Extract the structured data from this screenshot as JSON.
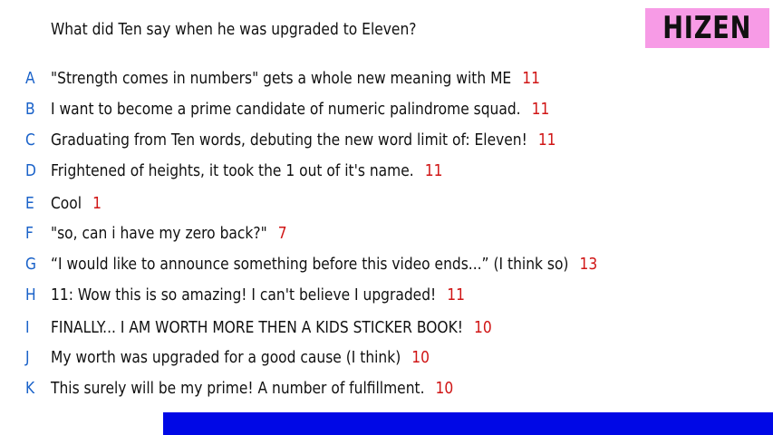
{
  "question": "What did Ten say when he was upgraded to Eleven?",
  "logo": "HIZEN",
  "colors": {
    "letter": "#1a62c9",
    "count": "#d01515",
    "logo_bg": "#f79be6",
    "bar": "#0008e6"
  },
  "answers": [
    {
      "letter": "A",
      "text": "\"Strength comes in numbers\" gets a whole new meaning with ME",
      "count": "11"
    },
    {
      "letter": "B",
      "text": "I want to become a prime candidate of numeric palindrome squad.",
      "count": "11"
    },
    {
      "letter": "C",
      "text": "Graduating from Ten words, debuting the new word limit of: Eleven!",
      "count": "11"
    },
    {
      "letter": "D",
      "text": "Frightened of heights, it took the 1 out of it's name.",
      "count": "11"
    },
    {
      "letter": "E",
      "text": "Cool",
      "count": "1"
    },
    {
      "letter": "F",
      "text": "\"so, can i have my zero back?\"",
      "count": "7"
    },
    {
      "letter": "G",
      "text": "“I would like to announce something before this video ends...” (I think so)",
      "count": "13"
    },
    {
      "letter": "H",
      "text": "11: Wow this is so amazing! I can't believe I upgraded!",
      "count": "11"
    },
    {
      "letter": "I",
      "text": "FINALLY... I AM WORTH MORE THEN A KIDS STICKER BOOK!",
      "count": "10"
    },
    {
      "letter": "J",
      "text": "My worth was upgraded for a good cause (I think)",
      "count": "10"
    },
    {
      "letter": "K",
      "text": "This surely will be my prime! A number of fulfillment.",
      "count": "10"
    }
  ]
}
